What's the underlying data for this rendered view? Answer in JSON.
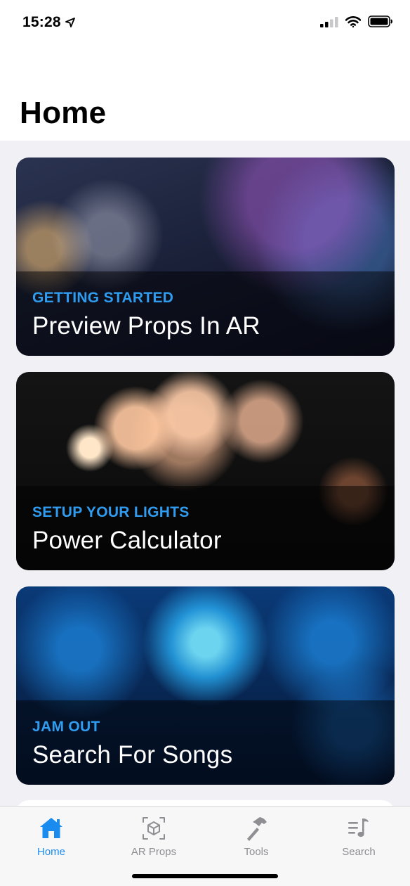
{
  "status_bar": {
    "time": "15:28",
    "location_icon": "location-arrow-icon",
    "signal_icon": "cellular-signal-icon",
    "wifi_icon": "wifi-icon",
    "battery_icon": "battery-icon"
  },
  "header": {
    "title": "Home"
  },
  "cards": [
    {
      "kicker": "GETTING STARTED",
      "title": "Preview Props In AR"
    },
    {
      "kicker": "SETUP YOUR LIGHTS",
      "title": "Power Calculator"
    },
    {
      "kicker": "JAM OUT",
      "title": "Search For Songs"
    }
  ],
  "tab_bar": {
    "items": [
      {
        "label": "Home",
        "icon": "house-icon",
        "active": true
      },
      {
        "label": "AR Props",
        "icon": "ar-cube-icon",
        "active": false
      },
      {
        "label": "Tools",
        "icon": "hammer-icon",
        "active": false
      },
      {
        "label": "Search",
        "icon": "music-list-icon",
        "active": false
      }
    ]
  },
  "colors": {
    "accent": "#1a8cf0",
    "kicker": "#2f9cf0",
    "inactive_tab": "#8e8e93",
    "background": "#f0f0f5"
  }
}
